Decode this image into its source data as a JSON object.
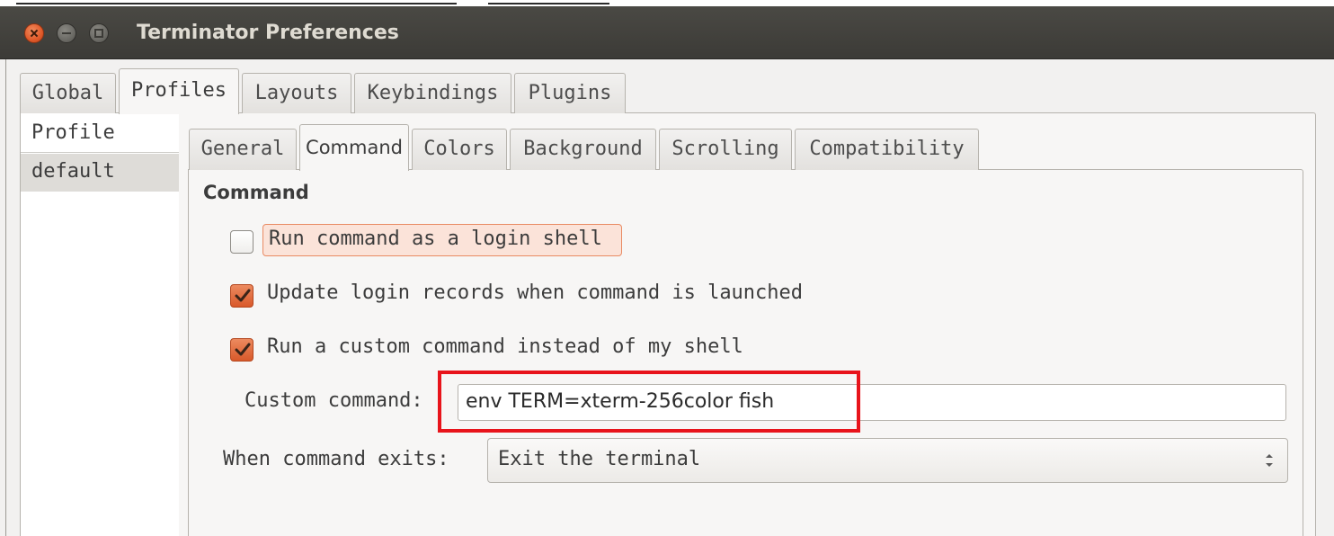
{
  "window": {
    "title": "Terminator Preferences"
  },
  "main_tabs": [
    {
      "label": "Global"
    },
    {
      "label": "Profiles"
    },
    {
      "label": "Layouts"
    },
    {
      "label": "Keybindings"
    },
    {
      "label": "Plugins"
    }
  ],
  "active_main_tab": "Profiles",
  "profile_list": {
    "header": "Profile",
    "items": [
      {
        "label": "default"
      }
    ],
    "selected": "default"
  },
  "profile_tabs": [
    {
      "label": "General"
    },
    {
      "label": "Command"
    },
    {
      "label": "Colors"
    },
    {
      "label": "Background"
    },
    {
      "label": "Scrolling"
    },
    {
      "label": "Compatibility"
    }
  ],
  "active_profile_tab": "Command",
  "command_section": {
    "title": "Command",
    "options": [
      {
        "label": "Run command as a login shell",
        "checked": false
      },
      {
        "label": "Update login records when command is launched",
        "checked": true
      },
      {
        "label": "Run a custom command instead of my shell",
        "checked": true
      }
    ],
    "custom_command": {
      "label": "Custom command:",
      "value": "env TERM=xterm-256color fish"
    },
    "exit_action": {
      "label": "When command exits:",
      "selected": "Exit the terminal"
    }
  },
  "colors": {
    "accent": "#e05a2a",
    "annotation": "#e8141b",
    "titlebar": "#3c3b37"
  }
}
